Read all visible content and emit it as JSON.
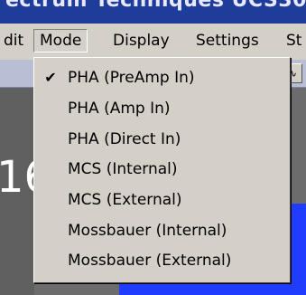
{
  "window": {
    "title": "ectrum Techniques   UCS30   b"
  },
  "menubar": {
    "items": [
      {
        "label": "dit",
        "active": false
      },
      {
        "label": "Mode",
        "active": true
      },
      {
        "label": "Display",
        "active": false
      },
      {
        "label": "Settings",
        "active": false
      },
      {
        "label": "St",
        "active": false
      }
    ]
  },
  "toolbar": {
    "right_button_icon": "waveform-icon"
  },
  "content": {
    "digits": "16"
  },
  "mode_menu": {
    "items": [
      {
        "label": "PHA (PreAmp In)",
        "checked": true,
        "check_glyph": "✔"
      },
      {
        "label": "PHA (Amp In)",
        "checked": false,
        "check_glyph": ""
      },
      {
        "label": "PHA (Direct In)",
        "checked": false,
        "check_glyph": ""
      },
      {
        "label": "MCS (Internal)",
        "checked": false,
        "check_glyph": ""
      },
      {
        "label": "MCS (External)",
        "checked": false,
        "check_glyph": ""
      },
      {
        "label": "Mossbauer (Internal)",
        "checked": false,
        "check_glyph": ""
      },
      {
        "label": "Mossbauer (External)",
        "checked": false,
        "check_glyph": ""
      }
    ]
  },
  "colors": {
    "titlebar": "#1e3c9a",
    "menu_bg": "#d4d0c8",
    "blue_panel": "#1f3cff"
  }
}
